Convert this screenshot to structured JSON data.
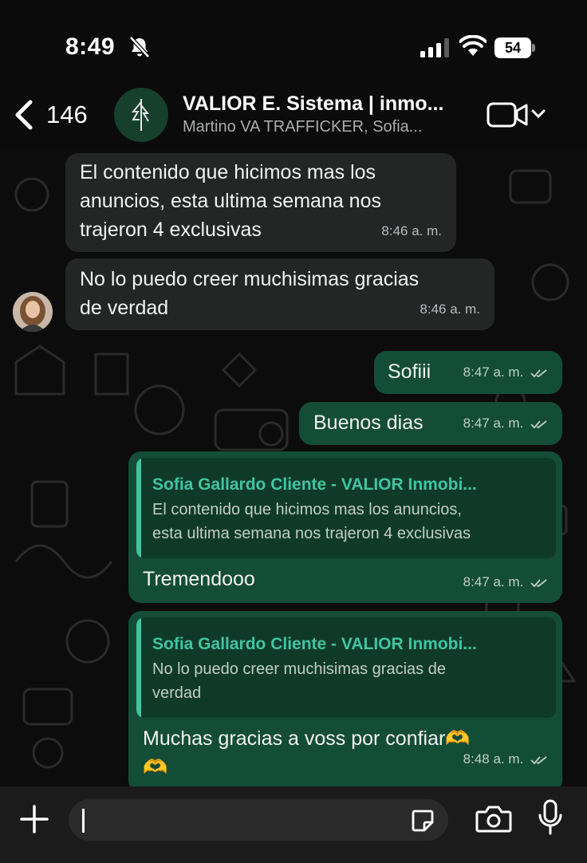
{
  "status_bar": {
    "time": "8:49",
    "battery_level": "54",
    "icons": [
      "bell-slash-icon",
      "cellular-signal-icon",
      "wifi-icon",
      "battery-icon"
    ]
  },
  "header": {
    "back_count": "146",
    "title": "VALIOR E. Sistema | inmo...",
    "subtitle": "Martino VA TRAFFICKER, Sofia...",
    "icons": [
      "back-chevron-icon",
      "group-avatar-logo",
      "video-call-icon",
      "chevron-down-icon"
    ]
  },
  "messages": [
    {
      "direction": "incoming",
      "text": "El contenido que hicimos mas los\nanuncios, esta ultima semana  nos\ntrajeron 4 exclusivas",
      "time": "8:46 a. m."
    },
    {
      "direction": "incoming",
      "text": "No lo puedo creer muchisimas gracias\nde verdad",
      "time": "8:46 a. m."
    },
    {
      "direction": "outgoing",
      "text": "Sofiii",
      "time": "8:47 a. m."
    },
    {
      "direction": "outgoing",
      "text": "Buenos dias",
      "time": "8:47 a. m."
    },
    {
      "direction": "outgoing",
      "quote_author": "Sofia Gallardo Cliente - VALIOR Inmobi...",
      "quote_text": "El contenido que hicimos mas los anuncios,\nesta ultima semana  nos trajeron 4 exclusivas",
      "text": "Tremendooo",
      "time": "8:47 a. m."
    },
    {
      "direction": "outgoing",
      "quote_author": "Sofia Gallardo Cliente - VALIOR Inmobi...",
      "quote_text": "No lo puedo creer muchisimas gracias de\nverdad",
      "text": "Muchas gracias a voss por confiar🫶\n🫶",
      "time": "8:48 a. m."
    }
  ],
  "composer": {
    "icons": [
      "plus-icon",
      "sticker-icon",
      "camera-icon",
      "microphone-icon"
    ]
  },
  "colors": {
    "incoming_bubble": "#242626",
    "outgoing_bubble": "#144d37",
    "quote_accent": "#3fc5a0",
    "background": "#0b0b0b"
  }
}
